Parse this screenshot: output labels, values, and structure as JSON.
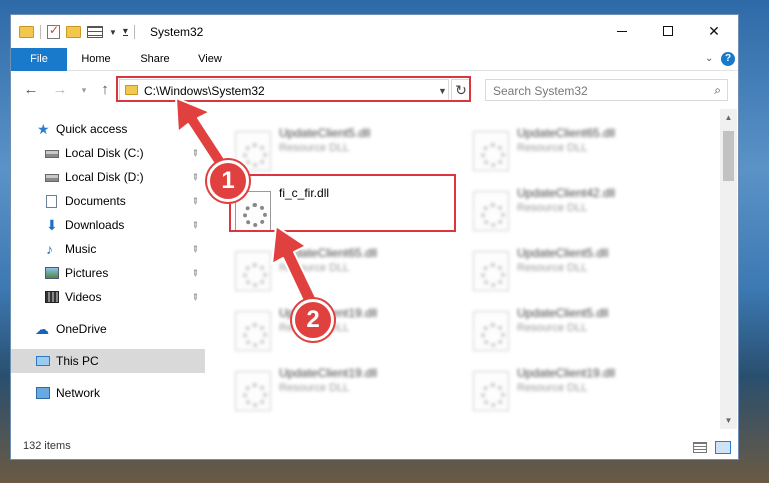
{
  "window": {
    "title": "System32"
  },
  "ribbon": {
    "tabs": [
      "File",
      "Home",
      "Share",
      "View"
    ],
    "help": "?"
  },
  "navbar": {
    "address": "C:\\Windows\\System32",
    "search_placeholder": "Search System32"
  },
  "sidebar": {
    "items": [
      {
        "label": "Quick access",
        "icon": "star-icon"
      },
      {
        "label": "Local Disk (C:)",
        "icon": "disk-icon",
        "pinned": true
      },
      {
        "label": "Local Disk (D:)",
        "icon": "disk-icon",
        "pinned": true
      },
      {
        "label": "Documents",
        "icon": "documents-icon",
        "pinned": true
      },
      {
        "label": "Downloads",
        "icon": "download-icon",
        "pinned": true
      },
      {
        "label": "Music",
        "icon": "music-icon",
        "pinned": true
      },
      {
        "label": "Pictures",
        "icon": "pictures-icon",
        "pinned": true
      },
      {
        "label": "Videos",
        "icon": "videos-icon",
        "pinned": true
      },
      {
        "label": "OneDrive",
        "icon": "cloud-icon"
      },
      {
        "label": "This PC",
        "icon": "computer-icon",
        "selected": true
      },
      {
        "label": "Network",
        "icon": "network-icon"
      }
    ]
  },
  "files": [
    {
      "name": "UpdateClient5.dll",
      "type": "Resource DLL"
    },
    {
      "name": "UpdateClient65.dll",
      "type": "Resource DLL"
    },
    {
      "name": "fi_c_fir.dll",
      "type": ""
    },
    {
      "name": "UpdateClient42.dll",
      "type": "Resource DLL"
    },
    {
      "name": "UpdateClient65.dll",
      "type": "Resource DLL"
    },
    {
      "name": "UpdateClient5.dll",
      "type": "Resource DLL"
    },
    {
      "name": "UpdateClient19.dll",
      "type": "Resource DLL"
    },
    {
      "name": "UpdateClient5.dll",
      "type": "Resource DLL"
    },
    {
      "name": "UpdateClient19.dll",
      "type": "Resource DLL"
    },
    {
      "name": "UpdateClient19.dll",
      "type": "Resource DLL"
    }
  ],
  "status": {
    "count": "132 items"
  },
  "annotations": {
    "step1": "1",
    "step2": "2",
    "color": "#e0413f"
  }
}
